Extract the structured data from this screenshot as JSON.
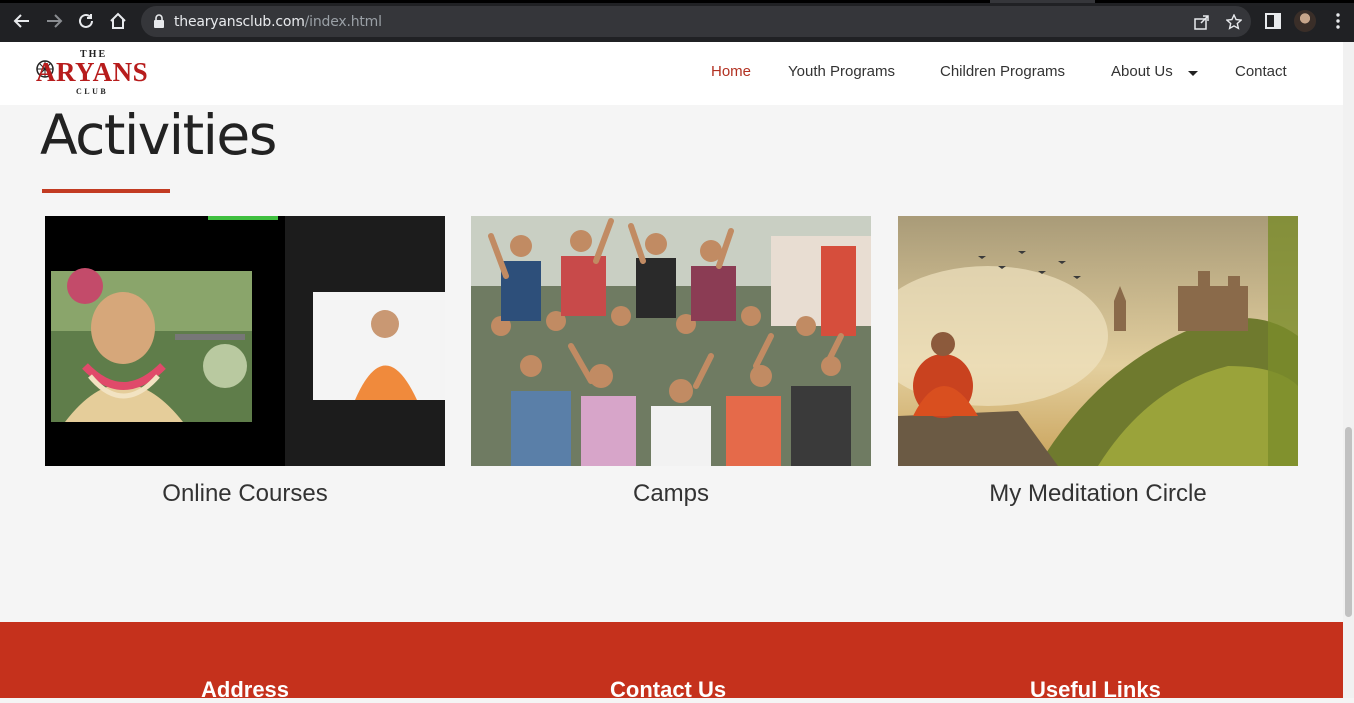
{
  "browser": {
    "url_host": "thearyansclub.com",
    "url_path": "/index.html"
  },
  "site": {
    "logo": {
      "the": "THE",
      "name": "ARYANS",
      "club": "CLUB"
    },
    "nav": {
      "items": [
        "Home",
        "Youth Programs",
        "Children Programs",
        "About Us",
        "Contact"
      ],
      "active": "Home"
    }
  },
  "main": {
    "heading": "Activities",
    "cards": [
      {
        "title": "Online Courses",
        "image": "online-course-video-call"
      },
      {
        "title": "Camps",
        "image": "youth-camp-group-photo"
      },
      {
        "title": "My Meditation Circle",
        "image": "monk-meditating-castle-landscape"
      }
    ]
  },
  "footer": {
    "headings": [
      "Address",
      "Contact Us",
      "Useful Links"
    ]
  },
  "colors": {
    "accent": "#c5311c",
    "nav_active": "#b23121",
    "chrome": "#202124"
  }
}
